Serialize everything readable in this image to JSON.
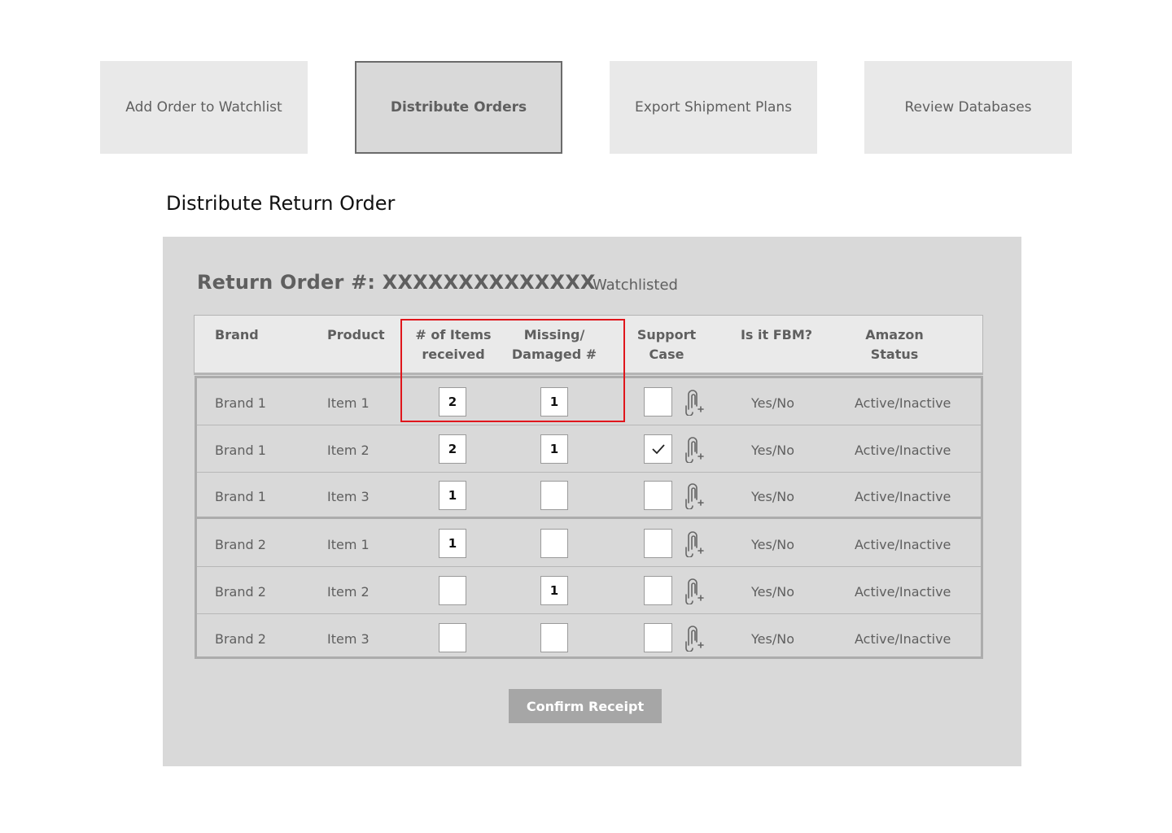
{
  "nav": {
    "items": [
      {
        "label": "Add Order to Watchlist"
      },
      {
        "label": "Distribute Orders"
      },
      {
        "label": "Export Shipment Plans"
      },
      {
        "label": "Review Databases"
      }
    ],
    "active_index": 1
  },
  "page": {
    "title": "Distribute Return Order"
  },
  "order": {
    "title": "Return Order #: XXXXXXXXXXXXXX",
    "watch_status": "Watchlisted"
  },
  "table": {
    "headers": {
      "brand": "Brand",
      "product": "Product",
      "items_received_1": "# of Items",
      "items_received_2": "received",
      "missing_1": "Missing/",
      "missing_2": "Damaged #",
      "support_1": "Support",
      "support_2": "Case",
      "fbm": "Is it FBM?",
      "amazon_1": "Amazon",
      "amazon_2": "Status"
    },
    "rows": [
      {
        "brand": "Brand 1",
        "product": "Item 1",
        "received": "2",
        "missing": "1",
        "support_checked": false,
        "fbm": "Yes/No",
        "status": "Active/Inactive"
      },
      {
        "brand": "Brand 1",
        "product": "Item 2",
        "received": "2",
        "missing": "1",
        "support_checked": true,
        "fbm": "Yes/No",
        "status": "Active/Inactive"
      },
      {
        "brand": "Brand 1",
        "product": "Item 3",
        "received": "1",
        "missing": "",
        "support_checked": false,
        "fbm": "Yes/No",
        "status": "Active/Inactive"
      },
      {
        "brand": "Brand 2",
        "product": "Item 1",
        "received": "1",
        "missing": "",
        "support_checked": false,
        "fbm": "Yes/No",
        "status": "Active/Inactive"
      },
      {
        "brand": "Brand 2",
        "product": "Item 2",
        "received": "",
        "missing": "1",
        "support_checked": false,
        "fbm": "Yes/No",
        "status": "Active/Inactive"
      },
      {
        "brand": "Brand 2",
        "product": "Item 3",
        "received": "",
        "missing": "",
        "support_checked": false,
        "fbm": "Yes/No",
        "status": "Active/Inactive"
      }
    ]
  },
  "icons": {
    "attach": "paperclip-plus-icon",
    "check": "checkmark-icon"
  },
  "colors": {
    "highlight": "#e0161c",
    "panel": "#d9d9d9",
    "button": "#a6a6a6"
  },
  "actions": {
    "confirm_label": "Confirm Receipt"
  }
}
